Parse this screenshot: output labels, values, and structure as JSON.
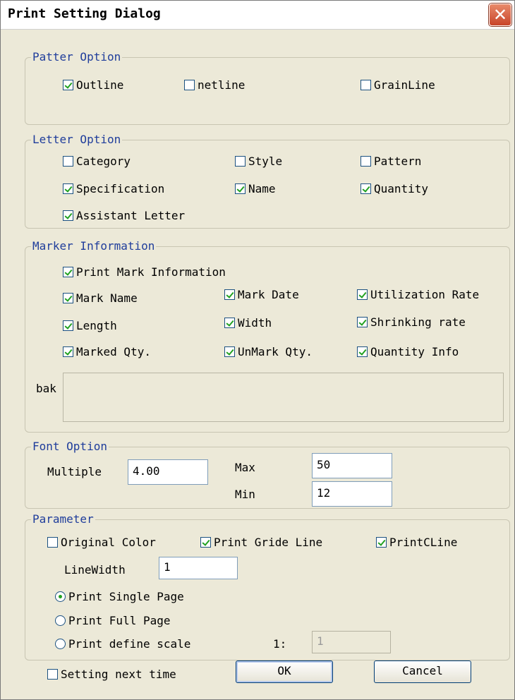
{
  "dialog": {
    "title": "Print Setting Dialog",
    "close_glyph": "✕"
  },
  "pattern_option": {
    "legend": "Patter Option",
    "items": [
      {
        "label": "Outline",
        "checked": true
      },
      {
        "label": "netline",
        "checked": false
      },
      {
        "label": "GrainLine",
        "checked": false
      }
    ]
  },
  "letter_option": {
    "legend": "Letter Option",
    "items": [
      {
        "label": "Category",
        "checked": false
      },
      {
        "label": "Style",
        "checked": false
      },
      {
        "label": "Pattern",
        "checked": false
      },
      {
        "label": "Specification",
        "checked": true
      },
      {
        "label": "Name",
        "checked": true
      },
      {
        "label": "Quantity",
        "checked": true
      },
      {
        "label": "Assistant Letter",
        "checked": true
      }
    ]
  },
  "marker_information": {
    "legend": "Marker Information",
    "items": [
      {
        "label": "Print Mark Information",
        "checked": true
      },
      {
        "label": "Mark Name",
        "checked": true
      },
      {
        "label": "Mark Date",
        "checked": true
      },
      {
        "label": "Utilization Rate",
        "checked": true
      },
      {
        "label": "Length",
        "checked": true
      },
      {
        "label": "Width",
        "checked": true
      },
      {
        "label": "Shrinking rate",
        "checked": true
      },
      {
        "label": "Marked Qty.",
        "checked": true
      },
      {
        "label": "UnMark Qty.",
        "checked": true
      },
      {
        "label": "Quantity Info",
        "checked": true
      }
    ],
    "bak_label": "bak"
  },
  "font_option": {
    "legend": "Font Option",
    "multiple_label": "Multiple",
    "multiple_value": "4.00",
    "max_label": "Max",
    "max_value": "50",
    "min_label": "Min",
    "min_value": "12"
  },
  "parameter": {
    "legend": "Parameter",
    "checkboxes": [
      {
        "label": "Original Color",
        "checked": false
      },
      {
        "label": "Print Gride Line",
        "checked": true
      },
      {
        "label": "PrintCLine",
        "checked": true
      }
    ],
    "line_width_label": "LineWidth",
    "line_width_value": "1",
    "radios": [
      {
        "label": "Print Single Page",
        "checked": true
      },
      {
        "label": "Print Full Page",
        "checked": false
      },
      {
        "label": "Print define scale",
        "checked": false
      }
    ],
    "scale_label": "1:",
    "scale_value": "1"
  },
  "footer": {
    "setting_next_time": {
      "label": "Setting next time",
      "checked": false
    },
    "ok_label": "OK",
    "cancel_label": "Cancel"
  }
}
